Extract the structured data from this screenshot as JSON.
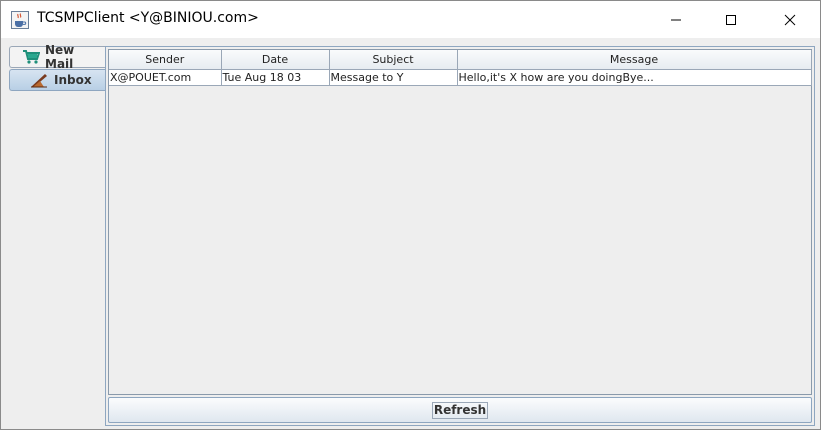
{
  "window": {
    "title": "TCSMPClient <Y@BINIOU.com>",
    "icon": "java-cup-icon",
    "controls": [
      "minimize-icon",
      "maximize-icon",
      "close-icon"
    ]
  },
  "tabs": [
    {
      "label": "New Mail",
      "icon": "cart-icon",
      "selected": false
    },
    {
      "label": "Inbox",
      "icon": "inbox-icon",
      "selected": true
    }
  ],
  "table": {
    "columns": [
      "Sender",
      "Date",
      "Subject",
      "Message"
    ],
    "rows": [
      {
        "sender": "X@POUET.com",
        "date": "Tue Aug 18 03",
        "subject": "Message to Y",
        "message": "Hello,it's X how are you doingBye..."
      }
    ]
  },
  "actions": {
    "refresh_label": "Refresh"
  },
  "colors": {
    "selected_tab": "#b8cfe5",
    "border": "#8ea6c0",
    "background": "#eeeeee"
  }
}
